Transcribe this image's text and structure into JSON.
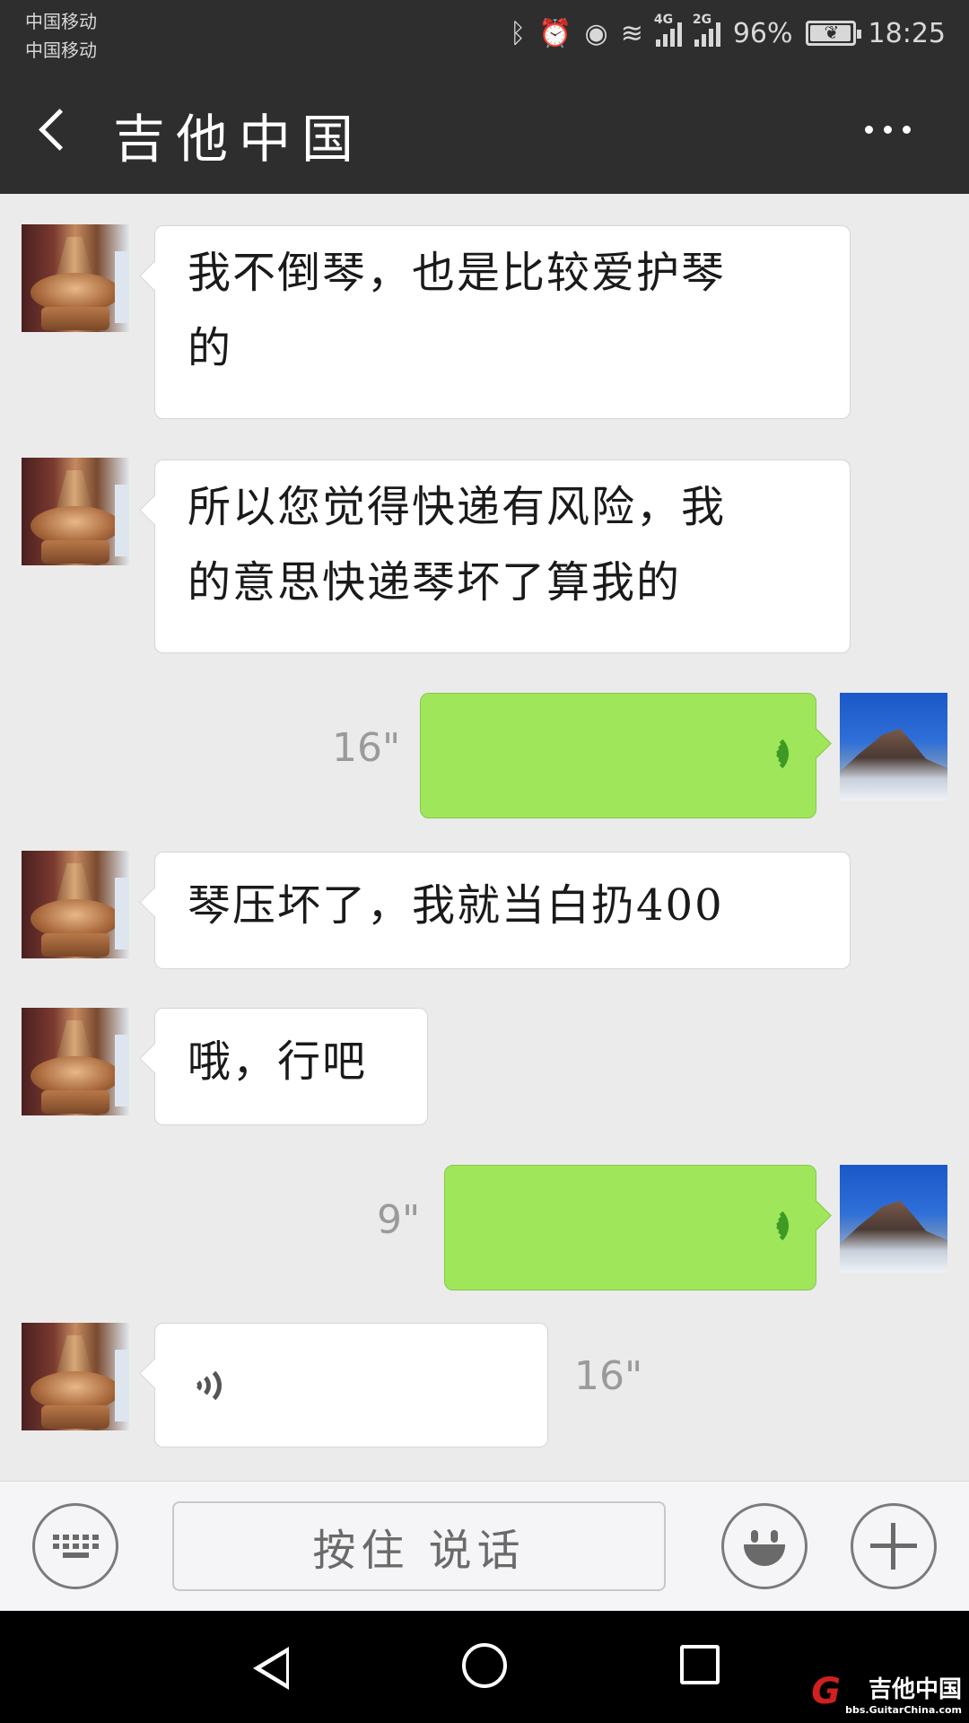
{
  "status_bar": {
    "carrier_1": "中国移动",
    "carrier_2": "中国移动",
    "network_1": "4G",
    "network_2": "2G",
    "battery": "96%",
    "time": "18:25",
    "icons": [
      "bluetooth-icon",
      "alarm-icon",
      "eye-icon",
      "wifi-icon",
      "signal-icon",
      "battery-icon"
    ]
  },
  "header": {
    "title": "吉他中国"
  },
  "messages": [
    {
      "side": "in",
      "type": "text",
      "line1": "我不倒琴，也是比较爱护琴",
      "line2": "的"
    },
    {
      "side": "in",
      "type": "text",
      "line1": "所以您觉得快递有风险，我",
      "line2": "的意思快递琴坏了算我的"
    },
    {
      "side": "out",
      "type": "voice",
      "duration": "16\""
    },
    {
      "side": "in",
      "type": "text",
      "line1": "琴压坏了，我就当白扔400"
    },
    {
      "side": "in",
      "type": "text",
      "line1": "哦，行吧"
    },
    {
      "side": "out",
      "type": "voice",
      "duration": "9\""
    },
    {
      "side": "in",
      "type": "voice",
      "duration": "16\""
    }
  ],
  "input_bar": {
    "hold_to_talk": "按住 说话"
  },
  "watermark": {
    "main": "吉他中国",
    "sub": "bbs.GuitarChina.com"
  },
  "colors": {
    "header_bg": "#2e2e2e",
    "chat_bg": "#ebebeb",
    "outgoing_bubble": "#9fe65b",
    "incoming_bubble": "#ffffff"
  }
}
